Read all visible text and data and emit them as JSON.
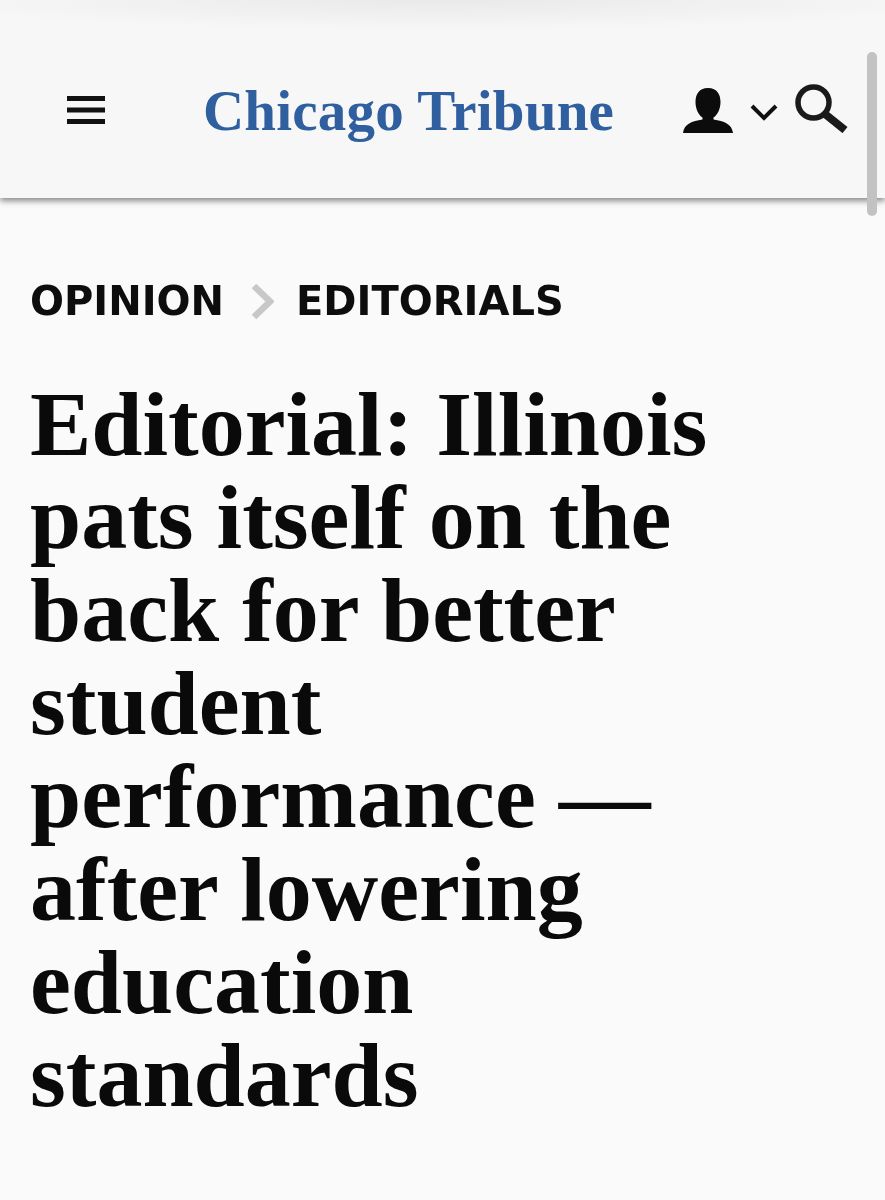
{
  "header": {
    "logo": "Chicago Tribune"
  },
  "breadcrumb": [
    {
      "label": "OPINION"
    },
    {
      "label": "EDITORIALS"
    }
  ],
  "headline": "Editorial: Illinois pats itself on the back for better student performance — after lowering education standards"
}
